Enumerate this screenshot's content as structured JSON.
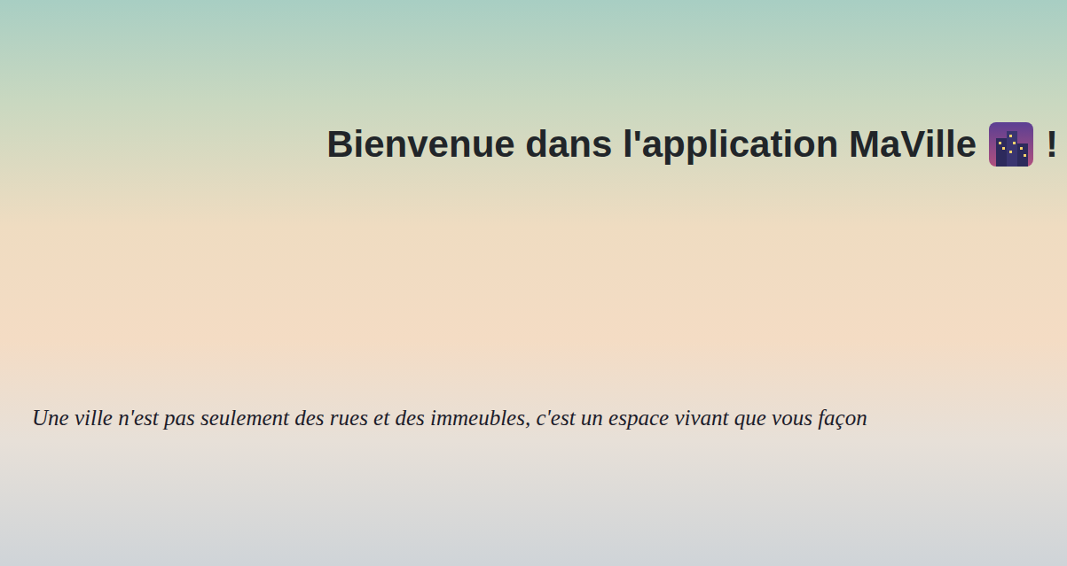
{
  "page": {
    "title": "Bienvenue dans l'application MaVille",
    "title_end": "!",
    "tagline": "Une ville n'est pas seulement des rues et des immeubles, c'est un espace vivant que vous façon"
  }
}
